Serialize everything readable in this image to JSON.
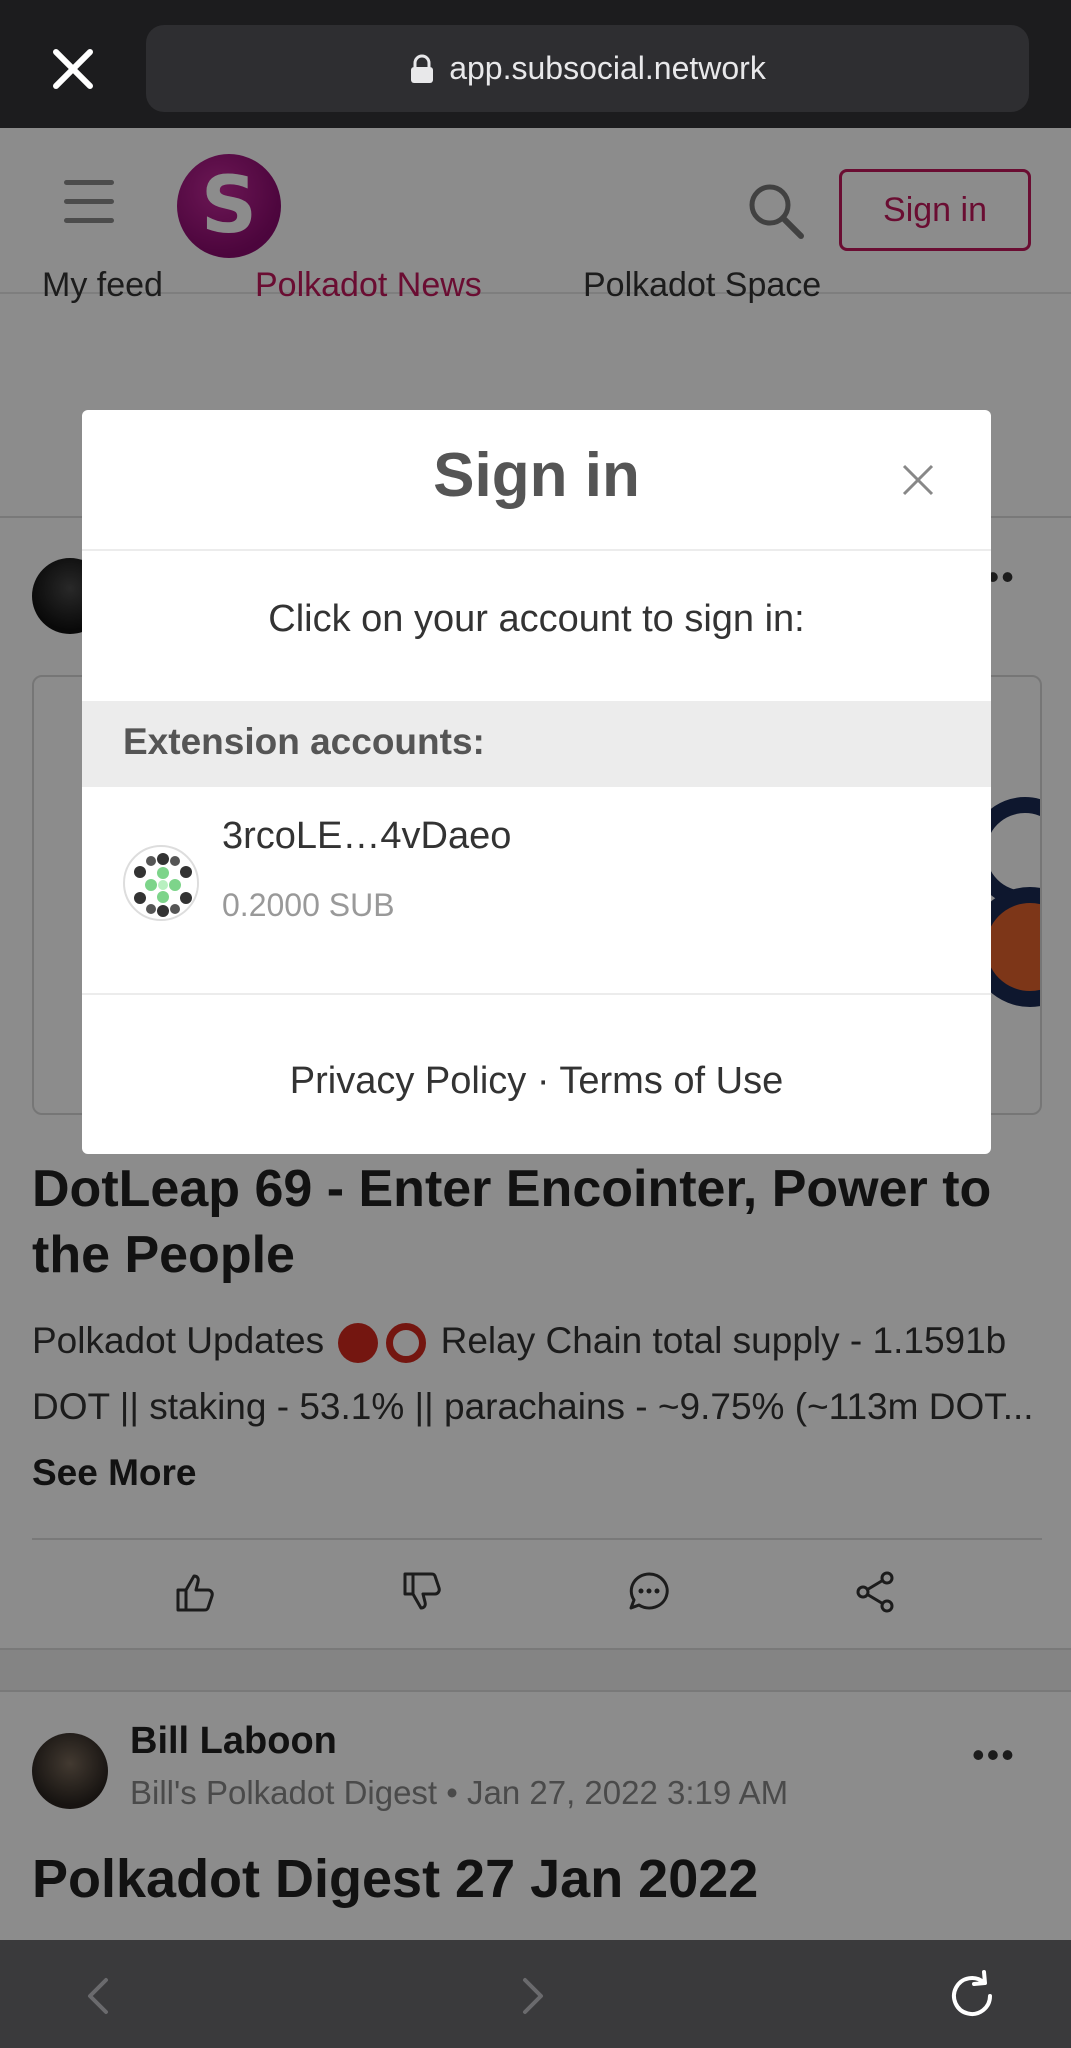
{
  "browser": {
    "url": "app.subsocial.network"
  },
  "header": {
    "logo_letter": "S",
    "signin_label": "Sign in"
  },
  "tabs": [
    {
      "label": "My feed"
    },
    {
      "label": "Polkadot News"
    },
    {
      "label": "Polkadot Space"
    }
  ],
  "post1": {
    "title": "DotLeap 69 - Enter Encointer, Power to the People",
    "summary_before": "Polkadot Updates ",
    "summary_after": " Relay Chain total supply - 1.1591b DOT || staking - 53.1% || parachains - ~9.75% (~113m DOT... ",
    "see_more": "See More"
  },
  "post2": {
    "author": "Bill Laboon",
    "meta": "Bill's Polkadot Digest • Jan 27, 2022 3:19 AM",
    "title": "Polkadot Digest 27 Jan 2022"
  },
  "modal": {
    "title": "Sign in",
    "instruction": "Click on your account to sign in:",
    "section_label": "Extension accounts:",
    "account": {
      "name": "3rcoLE…4vDaeo",
      "balance": "0.2000 SUB"
    },
    "footer_privacy": "Privacy Policy",
    "footer_sep": " · ",
    "footer_terms": "Terms of Use"
  },
  "colors": {
    "accent": "#c2185b",
    "overlay": "rgba(0,0,0,0.45)"
  }
}
